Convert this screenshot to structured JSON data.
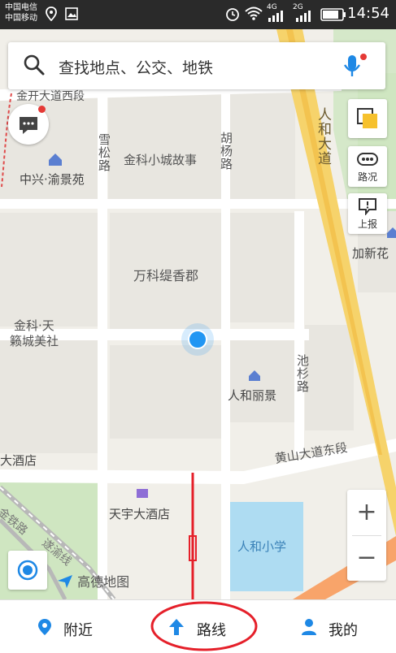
{
  "status_bar": {
    "carrier_1": "中国电信",
    "carrier_2": "中国移动",
    "network_1": "4G",
    "network_2": "2G",
    "time": "14:54"
  },
  "search": {
    "placeholder": "查找地点、公交、地铁"
  },
  "map": {
    "labels": {
      "road_top": "金开大道西段",
      "xuesong_road": "雪松路",
      "huyang_road": "胡杨路",
      "renhe_avenue": "人和大道",
      "jinke_story": "金科小城故事",
      "zhongxing": "中兴·渝景苑",
      "vanke": "万科缇香郡",
      "jinke_tian": "金科·天",
      "laicheng": "籁城美社",
      "renhe_lijing": "人和丽景",
      "chishan_road": "池杉路",
      "jiaxin": "加新花",
      "huangshan_road": "黄山大道东段",
      "dajiudian": "大酒店",
      "tianyu_hotel": "天宇大酒店",
      "renhe_school": "人和小学",
      "railway_1": "遂渝线",
      "railway_2": "金铁路"
    },
    "logo": "高德地图"
  },
  "map_buttons": {
    "traffic": "路况",
    "report": "上报",
    "zoom_in": "+",
    "zoom_out": "−"
  },
  "bottom_nav": {
    "nearby": "附近",
    "route": "路线",
    "mine": "我的"
  },
  "colors": {
    "accent_blue": "#1e88e5",
    "location_dot": "#2196f3",
    "annotation_red": "#e5202a",
    "avenue_yellow": "#f6d36b"
  }
}
